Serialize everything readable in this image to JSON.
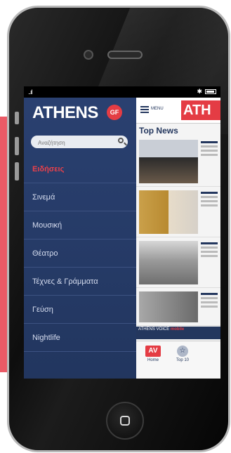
{
  "statusbar": {
    "signal": "..ıl",
    "bluetooth": "✱"
  },
  "menu": {
    "logo_text": "ATHENS",
    "logo_badge": "GF",
    "search_placeholder": "Αναζήτηση",
    "items": [
      {
        "label": "Ειδήσεις"
      },
      {
        "label": "Σινεμά"
      },
      {
        "label": "Μουσική"
      },
      {
        "label": "Θέατρο"
      },
      {
        "label": "Τέχνες & Γράμματα"
      },
      {
        "label": "Γεύση"
      },
      {
        "label": "Nightlife"
      }
    ]
  },
  "content": {
    "menu_label": "MENU",
    "brand": "ATH",
    "section_title": "Top News",
    "promo_text": "ATHENS VOICE",
    "promo_highlight": "mobile",
    "tabs": [
      {
        "icon_text": "AV",
        "label": "Home"
      },
      {
        "icon_text": "☆",
        "label": "Top 10"
      }
    ]
  },
  "colors": {
    "accent_red": "#e43c44",
    "menu_blue": "#24375e",
    "side_pink": "#ea5a66"
  }
}
